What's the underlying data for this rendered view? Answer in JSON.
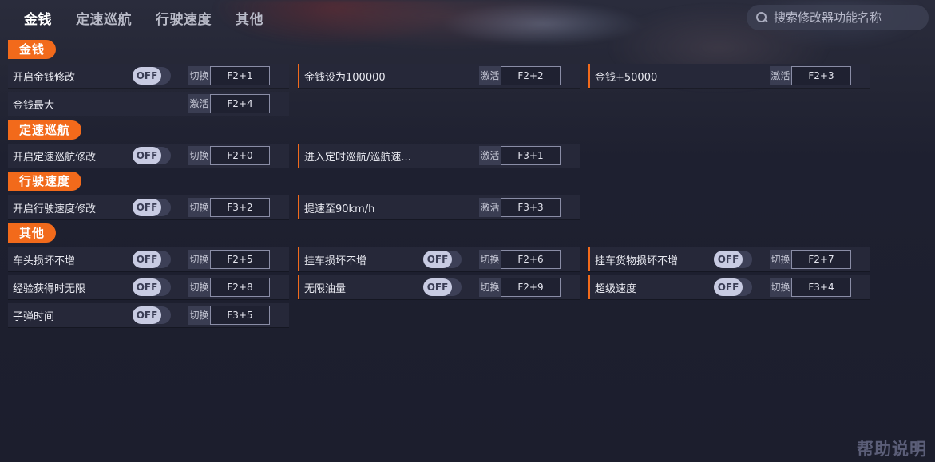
{
  "tabs": [
    "金钱",
    "定速巡航",
    "行驶速度",
    "其他"
  ],
  "search": {
    "placeholder": "搜索修改器功能名称"
  },
  "sections": {
    "money": "金钱",
    "cruise": "定速巡航",
    "speed": "行驶速度",
    "other": "其他"
  },
  "rows": {
    "money_enable": {
      "label": "开启金钱修改",
      "toggle": "OFF",
      "action": "切换",
      "key": "F2+1"
    },
    "money_set": {
      "label": "金钱设为100000",
      "action": "激活",
      "key": "F2+2"
    },
    "money_add": {
      "label": "金钱+50000",
      "action": "激活",
      "key": "F2+3"
    },
    "money_max": {
      "label": "金钱最大",
      "action": "激活",
      "key": "F2+4"
    },
    "cruise_enable": {
      "label": "开启定速巡航修改",
      "toggle": "OFF",
      "action": "切换",
      "key": "F2+0"
    },
    "cruise_enter": {
      "label": "进入定时巡航/巡航速...",
      "action": "激活",
      "key": "F3+1"
    },
    "speed_enable": {
      "label": "开启行驶速度修改",
      "toggle": "OFF",
      "action": "切换",
      "key": "F3+2"
    },
    "speed_90": {
      "label": "提速至90km/h",
      "action": "激活",
      "key": "F3+3"
    },
    "head_nodmg": {
      "label": "车头损坏不增",
      "toggle": "OFF",
      "action": "切换",
      "key": "F2+5"
    },
    "trailer_nodmg": {
      "label": "挂车损坏不增",
      "toggle": "OFF",
      "action": "切换",
      "key": "F2+6"
    },
    "cargo_nodmg": {
      "label": "挂车货物损坏不增",
      "toggle": "OFF",
      "action": "切换",
      "key": "F2+7"
    },
    "xp_unlimited": {
      "label": "经验获得时无限",
      "toggle": "OFF",
      "action": "切换",
      "key": "F2+8"
    },
    "fuel_unlimited": {
      "label": "无限油量",
      "toggle": "OFF",
      "action": "切换",
      "key": "F2+9"
    },
    "super_speed": {
      "label": "超级速度",
      "toggle": "OFF",
      "action": "切换",
      "key": "F3+4"
    },
    "bullet_time": {
      "label": "子弹时间",
      "toggle": "OFF",
      "action": "切换",
      "key": "F3+5"
    }
  },
  "help": "帮助说明",
  "colors": {
    "accent": "#f26a1b",
    "row_bg": "#262839",
    "bg": "#1c1e2e"
  }
}
